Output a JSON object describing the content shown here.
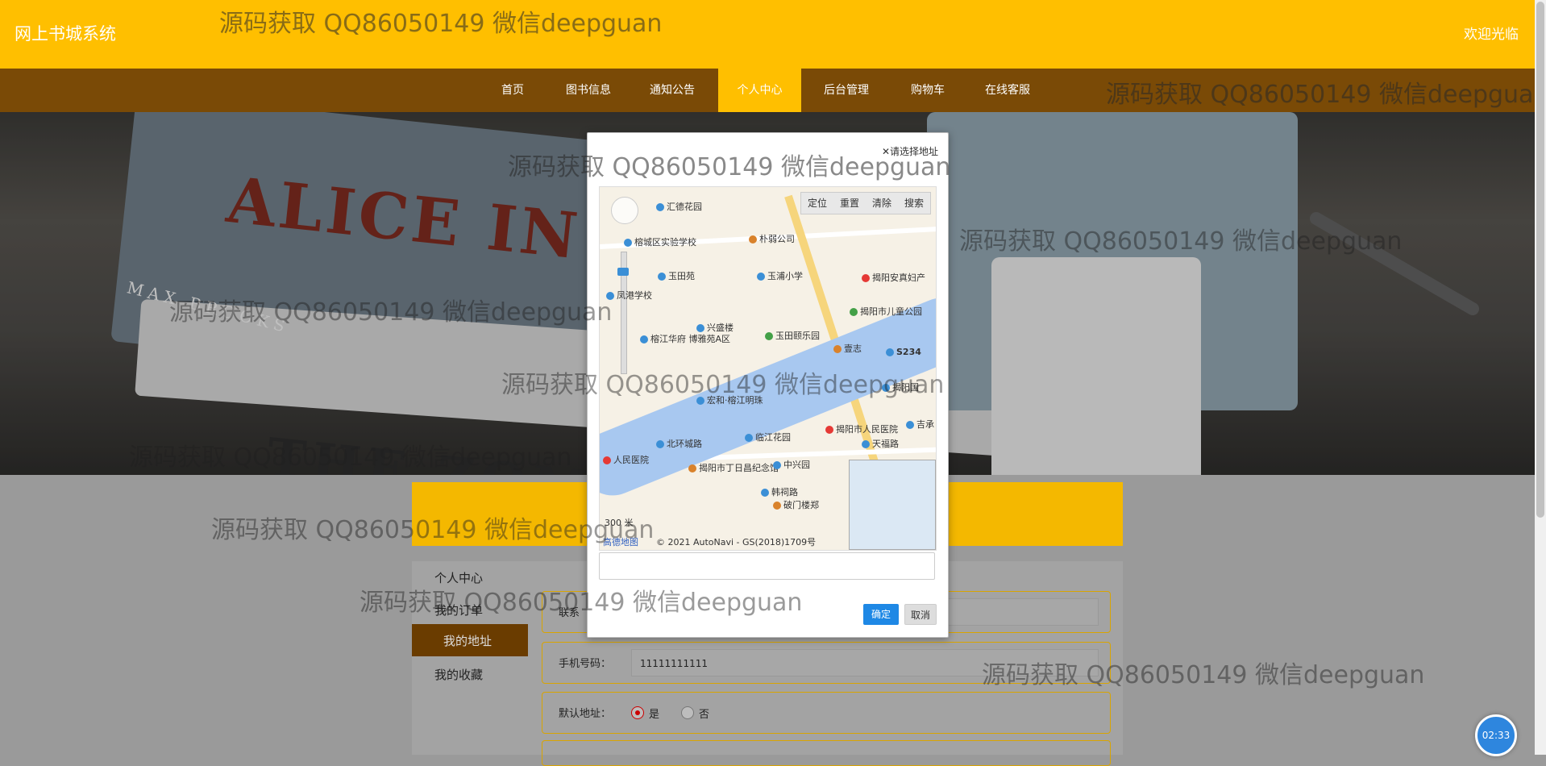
{
  "header": {
    "brand": "网上书城系统",
    "welcome": "欢迎光临"
  },
  "nav": {
    "items": [
      {
        "label": "首页"
      },
      {
        "label": "图书信息"
      },
      {
        "label": "通知公告"
      },
      {
        "label": "个人中心",
        "active": true
      },
      {
        "label": "后台管理"
      },
      {
        "label": "购物车"
      },
      {
        "label": "在线客服"
      }
    ]
  },
  "sidebar": {
    "items": [
      {
        "label": "个人中心"
      },
      {
        "label": "我的订单"
      },
      {
        "label": "我的地址",
        "active": true
      },
      {
        "label": "我的收藏"
      }
    ]
  },
  "form": {
    "contact_label": "联系",
    "phone_label": "手机号码：",
    "phone_value": "11111111111",
    "default_label": "默认地址：",
    "yes": "是",
    "no": "否"
  },
  "modal": {
    "close": "✕请选择地址",
    "toolbar": [
      "定位",
      "重置",
      "清除",
      "搜索"
    ],
    "confirm": "确定",
    "cancel": "取消",
    "address_value": "",
    "copyright": "© 2021 AutoNavi - GS(2018)1709号",
    "map_logo": "高德地图",
    "scale": "300 米",
    "pois": [
      "汇德花园",
      "榕城区实验学校",
      "朴弱公司",
      "玉田苑",
      "玉浦小学",
      "揭阳安真妇产",
      "凤港学校",
      "兴盛楼",
      "揭阳市儿童公园",
      "榕江华府 博雅苑A区",
      "玉田颐乐园",
      "壹志",
      "揭阳国",
      "宏和·榕江明珠",
      "临江花园",
      "揭阳市人民医院",
      "北环城路",
      "吉承",
      "人民医院",
      "揭阳市丁日昌纪念馆",
      "中兴园",
      "韩祠路",
      "破门楼郑",
      "天福路"
    ],
    "road_label": "S234"
  },
  "banner": {
    "title": "ALICE IN ZOM",
    "subtitle": "THE ZOMBIE",
    "author": "MAX BROOKS"
  },
  "watermark": "源码获取 QQ86050149 微信deepguan",
  "timer": "02:33",
  "colors": {
    "header": "#ffbf00",
    "nav": "#7a4a06",
    "accent": "#1e88e5"
  }
}
